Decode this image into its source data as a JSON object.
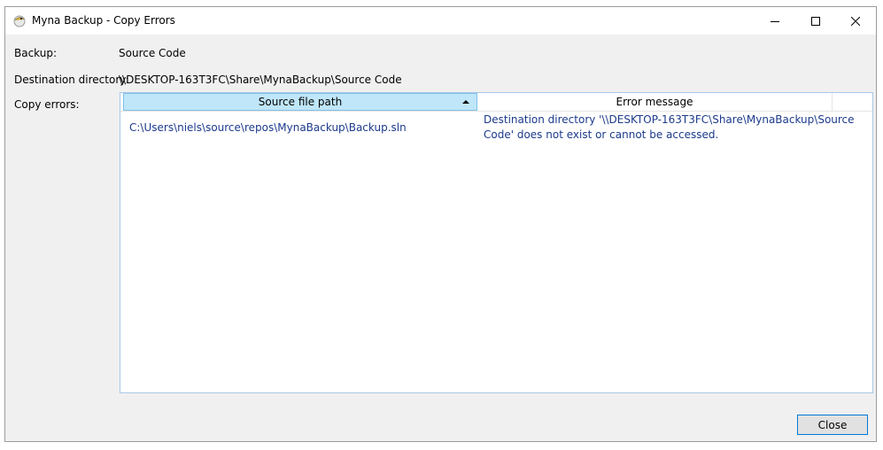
{
  "window": {
    "title": "Myna Backup - Copy Errors"
  },
  "fields": {
    "backup_label": "Backup:",
    "backup_value": "Source Code",
    "destination_label": "Destination directory:",
    "destination_value": "\\\\DESKTOP-163T3FC\\Share\\MynaBackup\\Source Code",
    "errors_label": "Copy errors:"
  },
  "grid": {
    "columns": [
      "Source file path",
      "Error message"
    ],
    "sorted_column": "Source file path",
    "sort_direction": "ascending",
    "rows": [
      {
        "path": "C:\\Users\\niels\\source\\repos\\MynaBackup\\Backup.sln",
        "error_line1": "Destination directory '\\\\DESKTOP-163T3FC\\Share\\MynaBackup\\Source",
        "error_line2": "Code' does not exist or cannot be accessed."
      }
    ]
  },
  "buttons": {
    "close": "Close"
  },
  "icons": {
    "app": "myna-app-icon",
    "minimize": "minimize-icon",
    "maximize": "maximize-icon",
    "close": "close-icon"
  },
  "colors": {
    "sorted_header_bg": "#bfe6f9",
    "cell_text": "#1c3a8c",
    "button_focus_border": "#0078d7"
  }
}
